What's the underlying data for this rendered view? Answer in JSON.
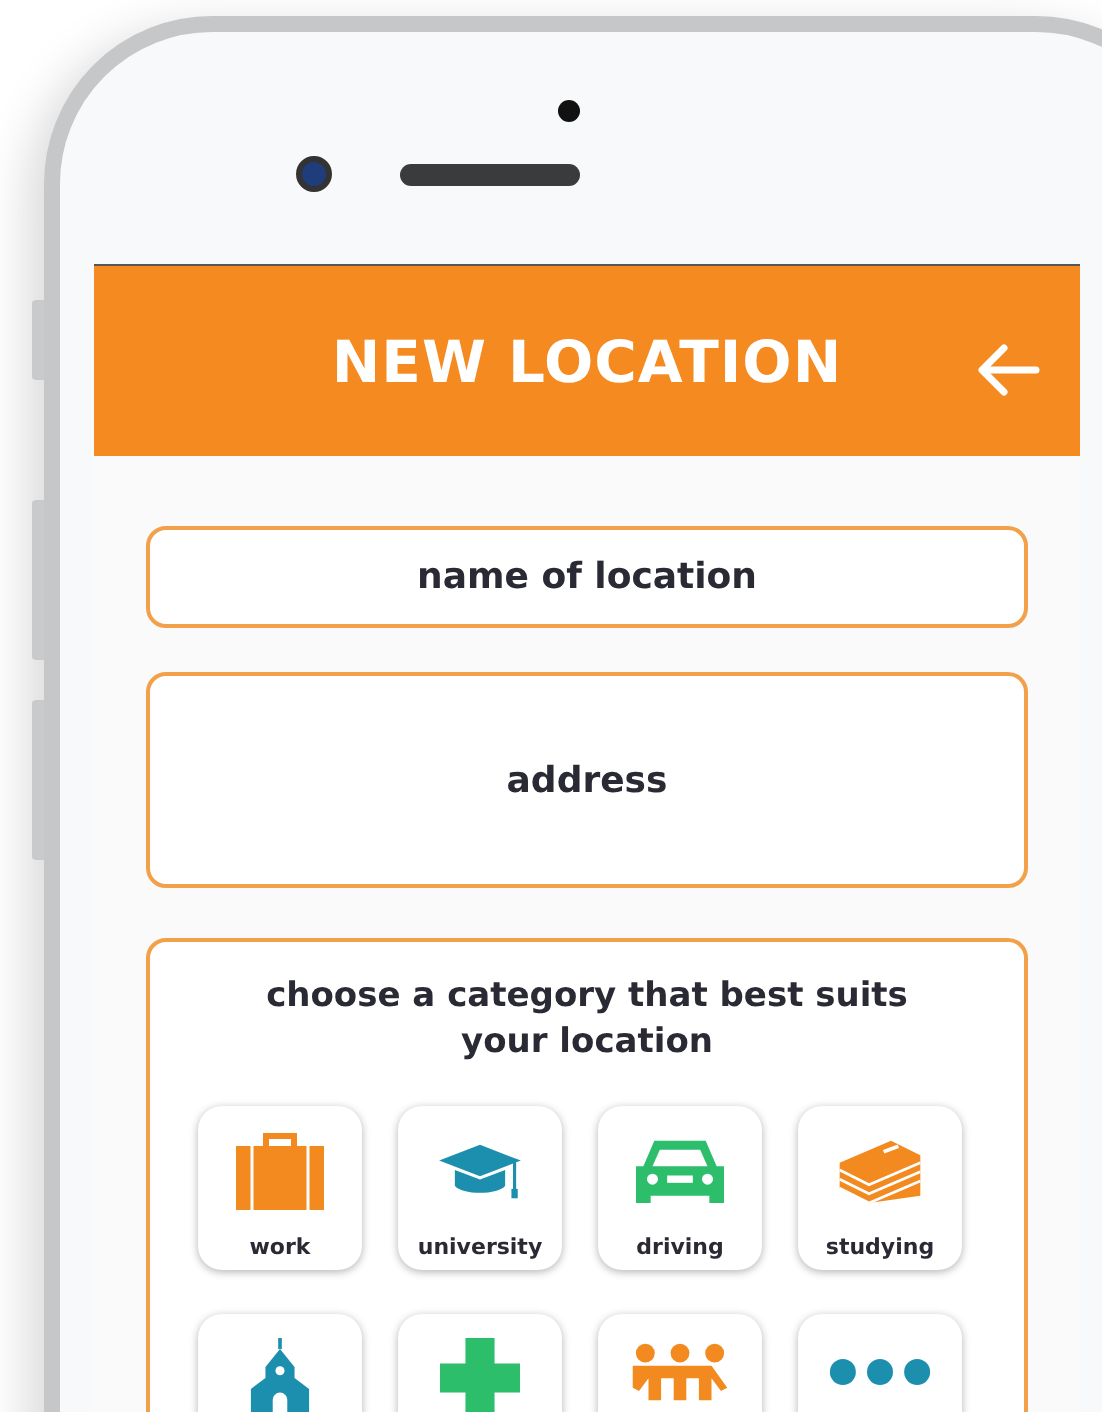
{
  "header": {
    "title": "NEW LOCATION"
  },
  "fields": [
    {
      "kind": "short",
      "placeholder": "name of location"
    },
    {
      "kind": "tall",
      "placeholder": "address"
    }
  ],
  "categories": {
    "prompt": "choose a category that best suits your location",
    "items": [
      {
        "kind": "briefcase",
        "label": "work"
      },
      {
        "kind": "cap",
        "label": "university"
      },
      {
        "kind": "car",
        "label": "driving"
      },
      {
        "kind": "books",
        "label": "studying"
      },
      {
        "kind": "church"
      },
      {
        "kind": "cross"
      },
      {
        "kind": "people"
      },
      {
        "kind": "dots"
      }
    ]
  }
}
